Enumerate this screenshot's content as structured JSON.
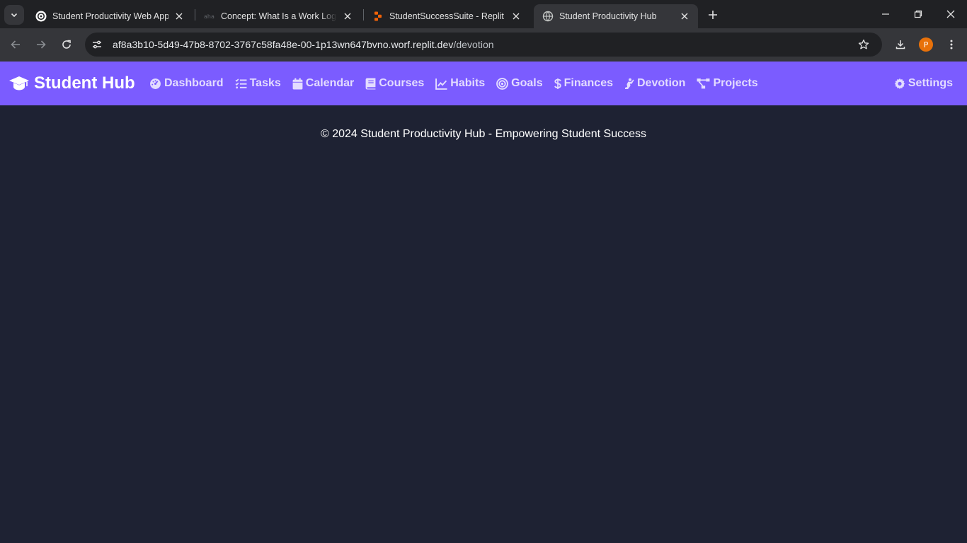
{
  "browser": {
    "tabs": [
      {
        "title": "Student Productivity Web App",
        "favicon": "openai-icon"
      },
      {
        "title": "Concept: What Is a Work Log and",
        "favicon": "aha-icon"
      },
      {
        "title": "StudentSuccessSuite - Replit",
        "favicon": "replit-icon"
      },
      {
        "title": "Student Productivity Hub",
        "favicon": "globe-icon",
        "active": true
      }
    ],
    "url_host": "af8a3b10-5d49-47b8-8702-3767c58fa48e-00-1p13wn647bvno.worf.replit.dev",
    "url_path": "/devotion",
    "profile_initial": "P"
  },
  "app": {
    "brand": "Student Hub",
    "nav": [
      {
        "label": "Dashboard",
        "icon": "gauge-icon"
      },
      {
        "label": "Tasks",
        "icon": "tasks-icon"
      },
      {
        "label": "Calendar",
        "icon": "calendar-icon"
      },
      {
        "label": "Courses",
        "icon": "book-icon"
      },
      {
        "label": "Habits",
        "icon": "chart-line-icon"
      },
      {
        "label": "Goals",
        "icon": "bullseye-icon"
      },
      {
        "label": "Finances",
        "icon": "dollar-icon"
      },
      {
        "label": "Devotion",
        "icon": "praying-icon"
      },
      {
        "label": "Projects",
        "icon": "project-diagram-icon"
      }
    ],
    "settings_label": "Settings",
    "footer": "© 2024 Student Productivity Hub - Empowering Student Success",
    "colors": {
      "nav_bg": "#7b5cff",
      "page_bg": "#1e2233",
      "nav_text": "#e3dcff"
    }
  }
}
